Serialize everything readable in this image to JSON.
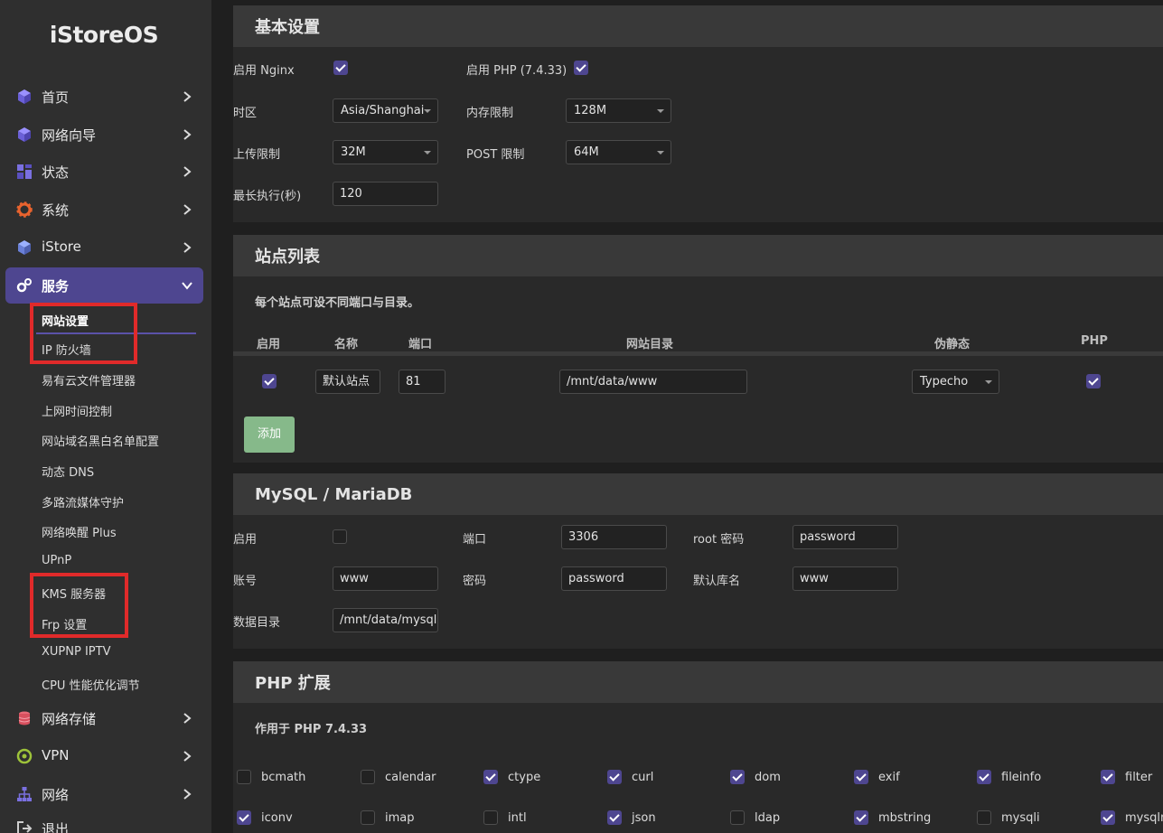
{
  "sidebar": {
    "logo": "iStoreOS",
    "nav": [
      {
        "label": "首页",
        "icon": "cube-icon"
      },
      {
        "label": "网络向导",
        "icon": "cube-icon"
      },
      {
        "label": "状态",
        "icon": "dashboard-icon"
      },
      {
        "label": "系统",
        "icon": "gear-icon"
      },
      {
        "label": "iStore",
        "icon": "cube-icon"
      },
      {
        "label": "服务",
        "icon": "gears-icon"
      }
    ],
    "services_sub": [
      "网站设置",
      "IP 防火墙",
      "易有云文件管理器",
      "上网时间控制",
      "网站域名黑白名单配置",
      "动态 DNS",
      "多路流媒体守护",
      "网络唤醒 Plus",
      "UPnP",
      "KMS 服务器",
      "Frp 设置",
      "XUPNP IPTV",
      "CPU 性能优化调节"
    ],
    "nav_bottom": [
      {
        "label": "网络存储",
        "icon": "database-icon"
      },
      {
        "label": "VPN",
        "icon": "vpn-icon"
      },
      {
        "label": "网络",
        "icon": "network-icon"
      },
      {
        "label": "退出",
        "icon": "logout-icon"
      }
    ]
  },
  "basic": {
    "title": "基本设置",
    "nginx_label": "启用 Nginx",
    "php_label": "启用 PHP (7.4.33)",
    "tz_label": "时区",
    "tz_value": "Asia/Shanghai",
    "mem_label": "内存限制",
    "mem_value": "128M",
    "upload_label": "上传限制",
    "upload_value": "32M",
    "post_label": "POST 限制",
    "post_value": "64M",
    "exec_label": "最长执行(秒)",
    "exec_value": "120"
  },
  "sites": {
    "title": "站点列表",
    "desc": "每个站点可设不同端口与目录。",
    "headers": {
      "enable": "启用",
      "name": "名称",
      "port": "端口",
      "dir": "网站目录",
      "rewrite": "伪静态",
      "php": "PHP"
    },
    "row": {
      "name": "默认站点",
      "port": "81",
      "dir": "/mnt/data/www",
      "rewrite": "Typecho"
    },
    "add_label": "添加"
  },
  "mysql": {
    "title": "MySQL / MariaDB",
    "enable_label": "启用",
    "port_label": "端口",
    "port_value": "3306",
    "rootpw_label": "root 密码",
    "rootpw_value": "password",
    "account_label": "账号",
    "account_value": "www",
    "pw_label": "密码",
    "pw_value": "password",
    "db_label": "默认库名",
    "db_value": "www",
    "datadir_label": "数据目录",
    "datadir_value": "/mnt/data/mysql"
  },
  "php_ext": {
    "title": "PHP 扩展",
    "desc": "作用于 PHP 7.4.33",
    "row1": [
      {
        "name": "bcmath",
        "on": false
      },
      {
        "name": "calendar",
        "on": false
      },
      {
        "name": "ctype",
        "on": true
      },
      {
        "name": "curl",
        "on": true
      },
      {
        "name": "dom",
        "on": true
      },
      {
        "name": "exif",
        "on": true
      },
      {
        "name": "fileinfo",
        "on": true
      },
      {
        "name": "filter",
        "on": true
      }
    ],
    "row2": [
      {
        "name": "iconv",
        "on": true
      },
      {
        "name": "imap",
        "on": false
      },
      {
        "name": "intl",
        "on": false
      },
      {
        "name": "json",
        "on": true
      },
      {
        "name": "ldap",
        "on": false
      },
      {
        "name": "mbstring",
        "on": true
      },
      {
        "name": "mysqli",
        "on": false
      },
      {
        "name": "mysqlnd",
        "on": true
      }
    ]
  }
}
